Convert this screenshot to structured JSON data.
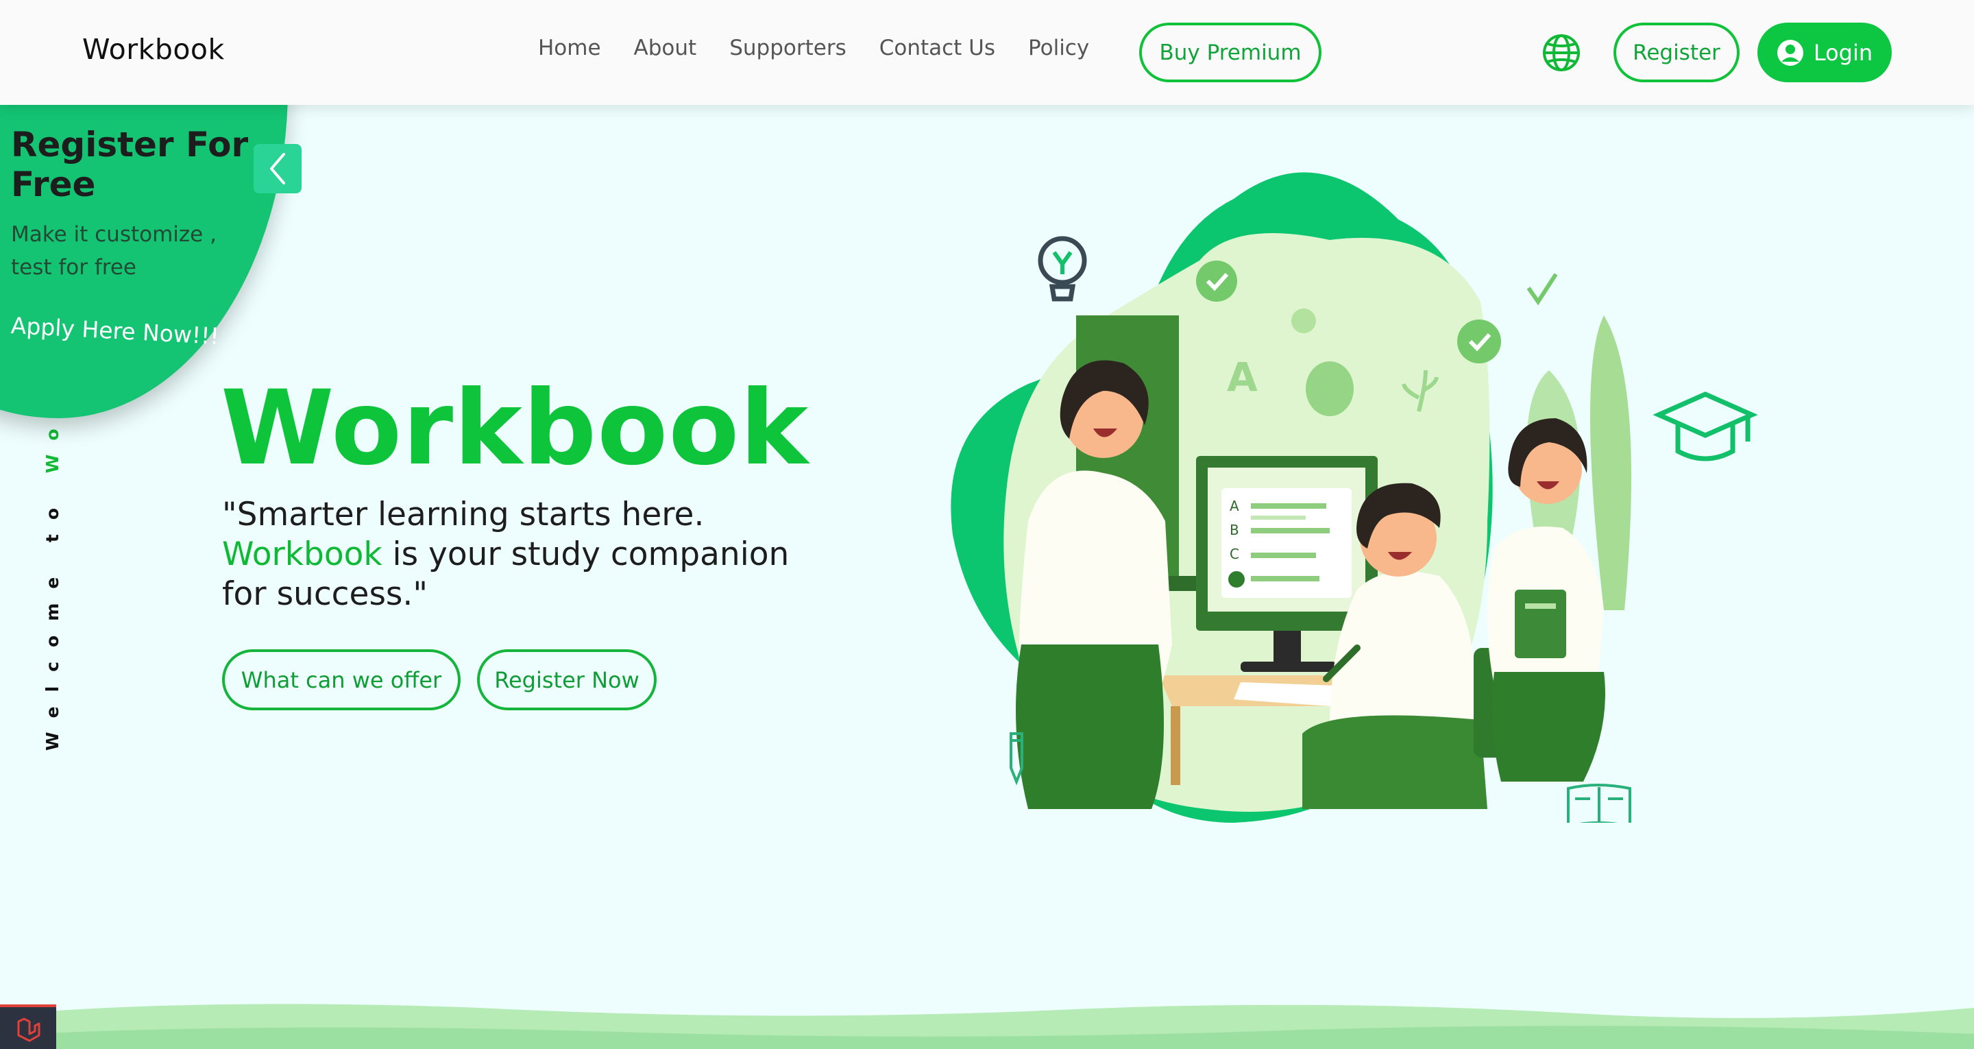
{
  "navbar": {
    "brand": "Workbook",
    "links": [
      "Home",
      "About",
      "Supporters",
      "Contact Us",
      "Policy"
    ],
    "premium_label": "Buy Premium",
    "register_label": "Register",
    "login_label": "Login"
  },
  "promo": {
    "title": "Register For Free",
    "subtitle": "Make it customize , test for free",
    "apply": "Apply Here Now!!!"
  },
  "vertical": {
    "text": "Welcome to ",
    "highlight": "Wor"
  },
  "hero": {
    "title": "Workbook",
    "quote_part1": "\"Smarter learning starts here.",
    "quote_highlight": "Workbook",
    "quote_part2": " is your study companion for success.\"",
    "btn_offer": "What can we offer",
    "btn_register": "Register Now"
  },
  "illustration": {
    "letter_a": "A",
    "options": [
      "A",
      "B",
      "C"
    ]
  },
  "colors": {
    "brand_green": "#0dc43a",
    "promo_green": "#14c473",
    "background": "#eefefe"
  }
}
